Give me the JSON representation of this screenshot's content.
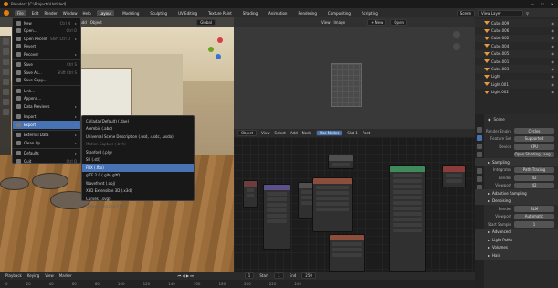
{
  "titlebar": {
    "title": "Blender* [C:\\Projects\\Untitled]",
    "controls": [
      "—",
      "☐",
      "✕"
    ]
  },
  "menubar": {
    "menus": [
      "File",
      "Edit",
      "Render",
      "Window",
      "Help"
    ],
    "workspaces": [
      "Layout",
      "Modeling",
      "Sculpting",
      "UV Editing",
      "Texture Paint",
      "Shading",
      "Animation",
      "Rendering",
      "Compositing",
      "Scripting"
    ],
    "active_workspace": "Layout",
    "scene_label": "Scene",
    "view_layer_label": "View Layer"
  },
  "viewport": {
    "mode": "Object Mode",
    "menus": [
      "View",
      "Select",
      "Add",
      "Object"
    ],
    "shading": "Global",
    "accent": "#e87d0d"
  },
  "file_menu": {
    "items": [
      {
        "label": "New",
        "shortcut": "Ctrl N",
        "arrow": "▸"
      },
      {
        "label": "Open...",
        "shortcut": "Ctrl O"
      },
      {
        "label": "Open Recent",
        "shortcut": "Shift Ctrl O",
        "arrow": "▸"
      },
      {
        "label": "Revert"
      },
      {
        "label": "Recover",
        "arrow": "▸"
      },
      {
        "label": "Save",
        "shortcut": "Ctrl S"
      },
      {
        "label": "Save As...",
        "shortcut": "Shift Ctrl S"
      },
      {
        "label": "Save Copy..."
      },
      {
        "label": "Link..."
      },
      {
        "label": "Append..."
      },
      {
        "label": "Data Previews",
        "arrow": "▸"
      },
      {
        "label": "Import",
        "arrow": "▸"
      },
      {
        "label": "Export",
        "arrow": "▸",
        "highlighted": true
      },
      {
        "label": "External Data",
        "arrow": "▸"
      },
      {
        "label": "Clean Up",
        "arrow": "▸"
      },
      {
        "label": "Defaults",
        "arrow": "▸"
      },
      {
        "label": "Quit",
        "shortcut": "Ctrl Q"
      }
    ]
  },
  "export_menu": {
    "items": [
      {
        "label": "Collada (Default) (.dae)"
      },
      {
        "label": "Alembic (.abc)"
      },
      {
        "label": "Universal Scene Description (.usd, .usdc, .usda)"
      },
      {
        "label": "Motion Capture (.bvh)",
        "disabled": true
      },
      {
        "label": "Stanford (.ply)"
      },
      {
        "label": "Stl (.stl)"
      },
      {
        "label": "FBX (.fbx)",
        "highlighted": true
      },
      {
        "label": "glTF 2.0 (.glb/.gltf)"
      },
      {
        "label": "Wavefront (.obj)"
      },
      {
        "label": "X3D Extensible 3D (.x3d)"
      },
      {
        "label": "Curves (.svg)"
      },
      {
        "label": "Grease Pencil as PDF",
        "disabled": true
      }
    ]
  },
  "image_editor": {
    "menus": [
      "View",
      "Image"
    ],
    "new_label": "+ New",
    "open_label": "Open"
  },
  "node_editor": {
    "object_label": "Object",
    "menus": [
      "View",
      "Select",
      "Add",
      "Node"
    ],
    "use_nodes_label": "Use Nodes",
    "slot_label": "Slot 1",
    "world_label": "Post"
  },
  "outliner": {
    "search_placeholder": "",
    "rows": [
      {
        "name": "Cube.009"
      },
      {
        "name": "Cube.006"
      },
      {
        "name": "Cube.002"
      },
      {
        "name": "Cube.004"
      },
      {
        "name": "Cube.005"
      },
      {
        "name": "Cube.001"
      },
      {
        "name": "Cube.003"
      },
      {
        "name": "Light"
      },
      {
        "name": "Light.001"
      },
      {
        "name": "Light.002"
      }
    ]
  },
  "properties": {
    "scene_label": "Scene",
    "rows": [
      {
        "label": "Render Engine",
        "value": "Cycles"
      },
      {
        "label": "Feature Set",
        "value": "Supported"
      },
      {
        "label": "Device",
        "value": "CPU"
      },
      {
        "label": "",
        "value": "Open Shading Lang..."
      },
      {
        "section": "Sampling"
      },
      {
        "label": "Integrator",
        "value": "Path Tracing"
      },
      {
        "label": "Render",
        "value": "42"
      },
      {
        "label": "Viewport",
        "value": "42"
      },
      {
        "section": "Adaptive Sampling"
      },
      {
        "section": "Denoising"
      },
      {
        "label": "Render",
        "value": "NLM"
      },
      {
        "label": "Viewport",
        "value": "Automatic"
      },
      {
        "label": "Start Sample",
        "value": "1"
      },
      {
        "section": "Advanced"
      },
      {
        "section": "Light Paths"
      },
      {
        "section": "Volumes"
      },
      {
        "section": "Hair"
      }
    ]
  },
  "timeline": {
    "menus": [
      "Playback",
      "Keying",
      "View",
      "Marker"
    ],
    "current_frame": "1",
    "start_label": "Start",
    "start": "1",
    "end_label": "End",
    "end": "250",
    "ruler": [
      "0",
      "20",
      "40",
      "60",
      "80",
      "100",
      "120",
      "140",
      "160",
      "180",
      "200",
      "220",
      "240"
    ]
  }
}
